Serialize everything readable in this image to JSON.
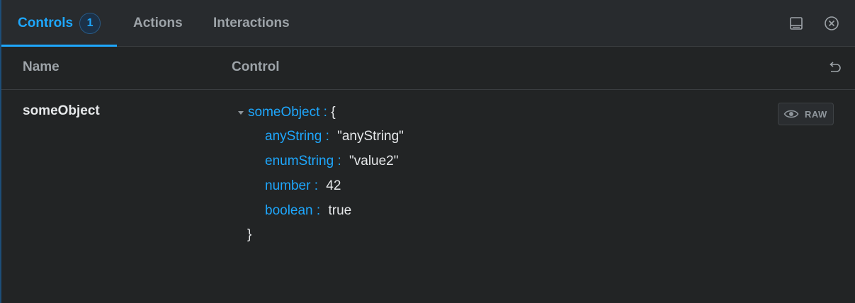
{
  "tabs": [
    {
      "label": "Controls",
      "badge": "1",
      "active": true
    },
    {
      "label": "Actions"
    },
    {
      "label": "Interactions"
    }
  ],
  "toolbar": {
    "panel_icon": "panel-layout-icon",
    "close_icon": "close-circle-icon"
  },
  "table": {
    "headers": {
      "name": "Name",
      "control": "Control"
    },
    "reset_icon": "undo-icon"
  },
  "row": {
    "name": "someObject",
    "object": {
      "root_key": "someObject",
      "root_sep": ":",
      "open_brace": "{",
      "close_brace": "}",
      "entries": [
        {
          "key": "anyString",
          "sep": ":",
          "value": "\"anyString\""
        },
        {
          "key": "enumString",
          "sep": ":",
          "value": "\"value2\""
        },
        {
          "key": "number",
          "sep": ":",
          "value": "42"
        },
        {
          "key": "boolean",
          "sep": ":",
          "value": "true"
        }
      ]
    },
    "raw_button": {
      "label": "RAW",
      "icon": "eye-icon"
    }
  },
  "colors": {
    "accent": "#1ea7fd",
    "background": "#222425",
    "tabbar": "#282b2e"
  }
}
